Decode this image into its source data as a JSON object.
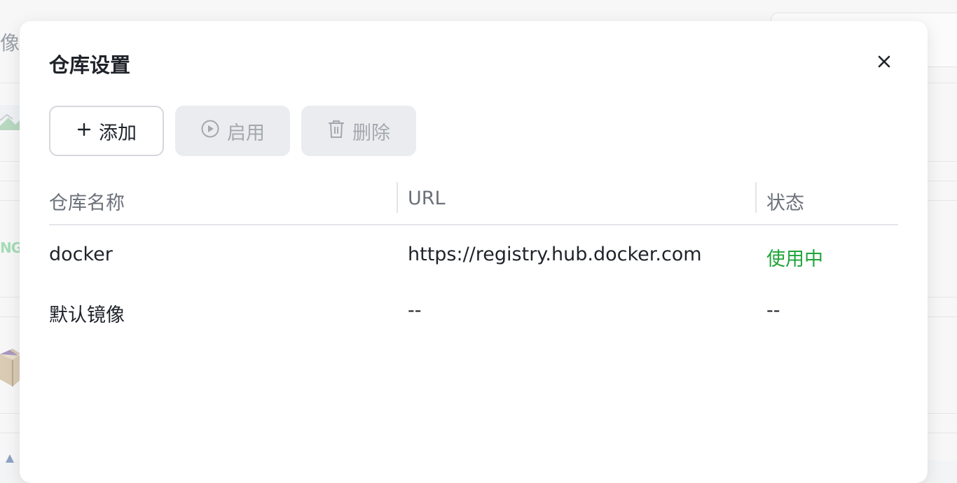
{
  "background": {
    "title_fragment": "像",
    "logo_fragment": "NG"
  },
  "modal": {
    "title": "仓库设置",
    "close_icon": "close-icon"
  },
  "toolbar": {
    "add_label": "添加",
    "enable_label": "启用",
    "delete_label": "删除",
    "add_icon": "plus-icon",
    "enable_icon": "play-circle-icon",
    "delete_icon": "trash-icon"
  },
  "table": {
    "columns": [
      "仓库名称",
      "URL",
      "状态"
    ],
    "rows": [
      {
        "name": "docker",
        "url": "https://registry.hub.docker.com",
        "status": "使用中",
        "status_color": "#20a43a"
      },
      {
        "name": "默认镜像",
        "url": "--",
        "status": "--",
        "status_color": "#1f2329"
      }
    ]
  },
  "colors": {
    "active_status": "#20a43a",
    "disabled_button_bg": "#ebecef",
    "disabled_text": "#a3a8b0"
  }
}
